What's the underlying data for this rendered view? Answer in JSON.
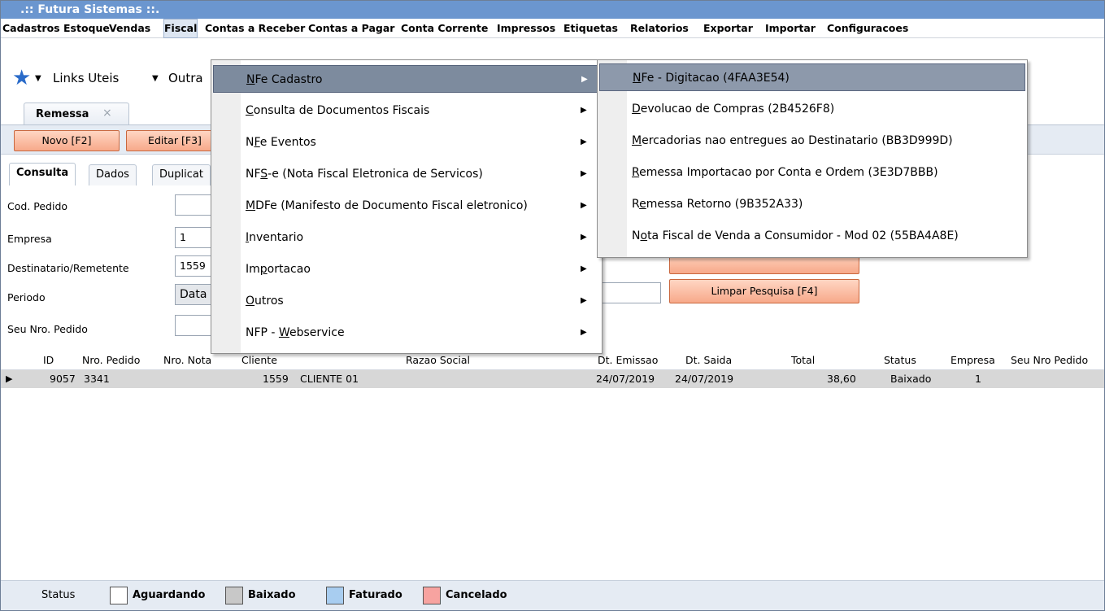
{
  "window": {
    "title": ".:: Futura Sistemas ::."
  },
  "menubar": {
    "items": [
      {
        "label": "Cadastros"
      },
      {
        "label": "Estoque"
      },
      {
        "label": "Vendas"
      },
      {
        "label": "Fiscal"
      },
      {
        "label": "Contas a Receber"
      },
      {
        "label": "Contas a Pagar"
      },
      {
        "label": "Conta Corrente"
      },
      {
        "label": "Impressos"
      },
      {
        "label": "Etiquetas"
      },
      {
        "label": "Relatorios"
      },
      {
        "label": "Exportar"
      },
      {
        "label": "Importar"
      },
      {
        "label": "Configuracoes"
      }
    ]
  },
  "links": {
    "links_label": "Links Uteis",
    "other_label": "Outra"
  },
  "doc_tab": {
    "label": "Remessa",
    "close": "×"
  },
  "toolbar": {
    "new_label": "Novo [F2]",
    "edit_label": "Editar [F3]"
  },
  "inner_tabs": [
    {
      "label": "Consulta"
    },
    {
      "label": "Dados"
    },
    {
      "label": "Duplicat"
    }
  ],
  "form": {
    "cod_pedido_label": "Cod. Pedido",
    "cod_pedido_value": "",
    "empresa_label": "Empresa",
    "empresa_value": "1",
    "destinatario_label": "Destinatario/Remetente",
    "destinatario_value": "1559",
    "periodo_label": "Periodo",
    "periodo_value": "Data",
    "seu_nro_label": "Seu Nro. Pedido",
    "seu_nro_value": "",
    "pesquisar_label": "",
    "limpar_label": "Limpar Pesquisa [F4]"
  },
  "grid": {
    "headers": [
      "ID",
      "Nro. Pedido",
      "Nro. Nota",
      "Cliente",
      "Razao Social",
      "Dt. Emissao",
      "Dt. Saida",
      "Total",
      "Status",
      "Empresa",
      "Seu Nro Pedido"
    ],
    "rows": [
      {
        "id": "9057",
        "nro_pedido": "3341",
        "nro_nota": "",
        "cliente": "1559",
        "razao_social": "CLIENTE 01",
        "dt_emissao": "24/07/2019",
        "dt_saida": "24/07/2019",
        "total": "38,60",
        "status": "Baixado",
        "empresa": "1",
        "seu_nro": ""
      }
    ]
  },
  "statusbar": {
    "label": "Status",
    "legend": [
      {
        "label": "Aguardando",
        "color": "#ffffff"
      },
      {
        "label": "Baixado",
        "color": "#c8c8c8"
      },
      {
        "label": "Faturado",
        "color": "#a8cdf0"
      },
      {
        "label": "Cancelado",
        "color": "#f7a3a0"
      }
    ]
  },
  "fiscal_menu": {
    "items": [
      {
        "label": "NFe Cadastro",
        "mnemonic": "N",
        "rest": "Fe Cadastro"
      },
      {
        "label": "Consulta de Documentos Fiscais",
        "mnemonic": "C",
        "rest": "onsulta de Documentos Fiscais"
      },
      {
        "label": "NFe Eventos",
        "pre": "N",
        "mnemonic": "F",
        "rest": "e Eventos"
      },
      {
        "label": "NFS-e (Nota Fiscal Eletronica de Servicos)",
        "pre": "NF",
        "mnemonic": "S",
        "rest": "-e (Nota Fiscal Eletronica de Servicos)"
      },
      {
        "label": "MDFe (Manifesto de Documento Fiscal eletronico)",
        "mnemonic": "M",
        "rest": "DFe (Manifesto de Documento Fiscal eletronico)"
      },
      {
        "label": "Inventario",
        "mnemonic": "I",
        "rest": "nventario"
      },
      {
        "label": "Importacao",
        "pre": "Im",
        "mnemonic": "p",
        "rest": "ortacao"
      },
      {
        "label": "Outros",
        "mnemonic": "O",
        "rest": "utros"
      },
      {
        "label": "NFP - Webservice",
        "pre": "NFP - ",
        "mnemonic": "W",
        "rest": "ebservice"
      }
    ]
  },
  "nfe_submenu": {
    "items": [
      {
        "label": "NFe - Digitacao (4FAA3E54)",
        "mnemonic": "N",
        "rest": "Fe - Digitacao (4FAA3E54)"
      },
      {
        "label": "Devolucao de Compras (2B4526F8)",
        "mnemonic": "D",
        "rest": "evolucao de Compras (2B4526F8)"
      },
      {
        "label": "Mercadorias nao entregues ao Destinatario (BB3D999D)",
        "mnemonic": "M",
        "rest": "ercadorias nao entregues ao Destinatario (BB3D999D)"
      },
      {
        "label": "Remessa Importacao por Conta e Ordem (3E3D7BBB)",
        "mnemonic": "R",
        "rest": "emessa Importacao por Conta e Ordem (3E3D7BBB)"
      },
      {
        "label": "Remessa Retorno (9B352A33)",
        "pre": "R",
        "mnemonic": "e",
        "rest": "messa Retorno (9B352A33)"
      },
      {
        "label": "Nota Fiscal de Venda a Consumidor - Mod 02 (55BA4A8E)",
        "pre": "N",
        "mnemonic": "o",
        "rest": "ta Fiscal de Venda a Consumidor - Mod 02 (55BA4A8E)"
      }
    ]
  }
}
